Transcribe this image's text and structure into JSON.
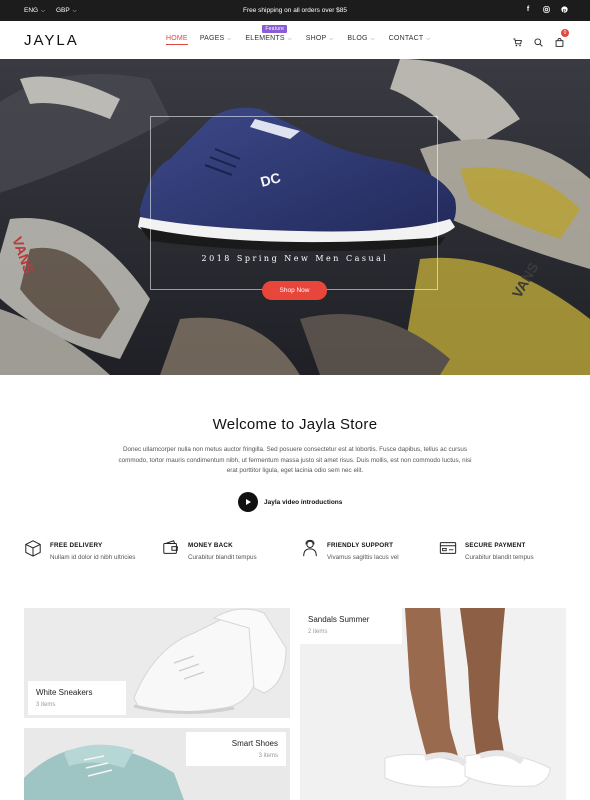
{
  "topbar": {
    "language": "ENG",
    "currency": "GBP",
    "promo": "Free shipping on all orders over $85",
    "social": [
      "facebook-icon",
      "instagram-icon",
      "pinterest-icon"
    ]
  },
  "header": {
    "logo": "JAYLA",
    "nav": [
      {
        "label": "HOME",
        "active": true
      },
      {
        "label": "PAGES"
      },
      {
        "label": "ELEMENTS",
        "badge": "Feature"
      },
      {
        "label": "SHOP"
      },
      {
        "label": "BLOG"
      },
      {
        "label": "CONTACT"
      }
    ],
    "cart_count": "0",
    "icons": [
      "cart-icon",
      "search-icon",
      "bag-icon"
    ]
  },
  "hero": {
    "caption": "2018 Spring New Men Casual",
    "button": "Shop Now"
  },
  "welcome": {
    "title": "Welcome to Jayla Store",
    "text": "Donec ullamcorper nulla non metus auctor fringilla. Sed posuere consectetur est at lobortis. Fusce dapibus, tellus ac cursus commodo, tortor mauris condimentum nibh, ut fermentum massa justo sit amet risus. Duis mollis, est non commodo luctus, nisi erat porttitor ligula, eget lacinia odio sem nec elit.",
    "video_label": "Jayla video introductions"
  },
  "features": [
    {
      "title": "FREE DELIVERY",
      "desc": "Nullam id dolor id nibh ultricies",
      "icon": "delivery-box-icon"
    },
    {
      "title": "MONEY BACK",
      "desc": "Curabitur blandit tempus",
      "icon": "wallet-icon"
    },
    {
      "title": "FRIENDLY SUPPORT",
      "desc": "Vivamus sagittis lacus vel",
      "icon": "support-agent-icon"
    },
    {
      "title": "SECURE PAYMENT",
      "desc": "Curabitur blandit tempus",
      "icon": "credit-card-icon"
    }
  ],
  "categories": [
    {
      "name": "White Sneakers",
      "count": "3 items"
    },
    {
      "name": "Sandals Summer",
      "count": "2 items"
    },
    {
      "name": "Smart Shoes",
      "count": "3 items"
    }
  ],
  "colors": {
    "accent": "#e8453b",
    "topbar": "#1c1c1c",
    "badge": "#8a5cd6"
  }
}
